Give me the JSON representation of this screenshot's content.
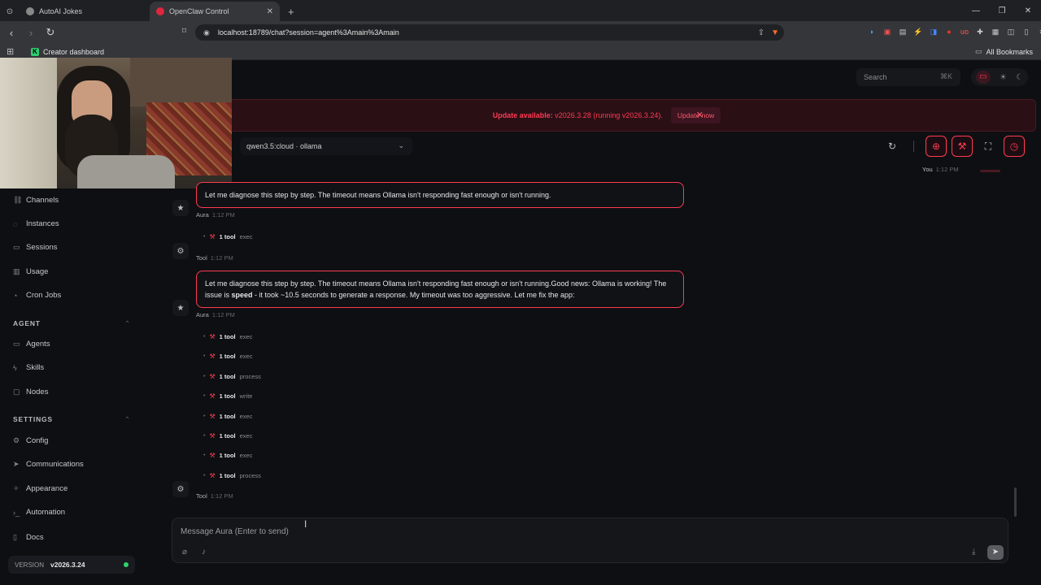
{
  "browser": {
    "tabs": [
      {
        "title": "AutoAI Jokes"
      },
      {
        "title": "OpenClaw Control"
      }
    ],
    "url": "localhost:18789/chat?session=agent%3Amain%3Amain",
    "bookmark": "Creator dashboard",
    "all_bookmarks": "All Bookmarks"
  },
  "header": {
    "search_placeholder": "Search",
    "search_kbd": "⌘K"
  },
  "banner": {
    "label": "Update available:",
    "version_text": "v2026.3.28 (running v2026.3.24).",
    "button": "Update now"
  },
  "model_selector": {
    "value": "qwen3.5:cloud · ollama"
  },
  "sidebar": {
    "items_top": [
      {
        "label": "Channels",
        "icon": "link-icon"
      },
      {
        "label": "Instances",
        "icon": "radio-icon"
      },
      {
        "label": "Sessions",
        "icon": "file-icon"
      },
      {
        "label": "Usage",
        "icon": "chart-icon"
      },
      {
        "label": "Cron Jobs",
        "icon": "clock-icon"
      }
    ],
    "section_agent": "AGENT",
    "items_agent": [
      {
        "label": "Agents",
        "icon": "folder-icon"
      },
      {
        "label": "Skills",
        "icon": "zap-icon"
      },
      {
        "label": "Nodes",
        "icon": "monitor-icon"
      }
    ],
    "section_settings": "SETTINGS",
    "items_settings": [
      {
        "label": "Config",
        "icon": "gear-icon"
      },
      {
        "label": "Communications",
        "icon": "send-icon"
      },
      {
        "label": "Appearance",
        "icon": "sparkle-icon"
      },
      {
        "label": "Automation",
        "icon": "terminal-icon"
      }
    ],
    "docs": "Docs",
    "version_label": "VERSION",
    "version_value": "v2026.3.24"
  },
  "chat": {
    "you_label": "You",
    "you_time": "1:12 PM",
    "msg1": "Let me diagnose this step by step. The timeout means Ollama isn't responding fast enough or isn't running.",
    "msg1_author": "Aura",
    "msg1_time": "1:12 PM",
    "tool_group1": [
      {
        "count": "1 tool",
        "name": "exec"
      }
    ],
    "tool1_author": "Tool",
    "tool1_time": "1:12 PM",
    "msg2_part1": "Let me diagnose this step by step. The timeout means Ollama isn't responding fast enough or isn't running.Good news: Ollama is working! The issue is ",
    "msg2_bold": "speed",
    "msg2_part2": " - it took ~10.5 seconds to generate a response. My timeout was too aggressive. Let me fix the app:",
    "msg2_author": "Aura",
    "msg2_time": "1:12 PM",
    "tool_group2": [
      {
        "count": "1 tool",
        "name": "exec"
      },
      {
        "count": "1 tool",
        "name": "exec"
      },
      {
        "count": "1 tool",
        "name": "process"
      },
      {
        "count": "1 tool",
        "name": "write"
      },
      {
        "count": "1 tool",
        "name": "exec"
      },
      {
        "count": "1 tool",
        "name": "exec"
      },
      {
        "count": "1 tool",
        "name": "exec"
      },
      {
        "count": "1 tool",
        "name": "process"
      }
    ],
    "tool2_author": "Tool",
    "tool2_time": "1:12 PM"
  },
  "composer": {
    "placeholder": "Message Aura (Enter to send)"
  },
  "colors": {
    "accent": "#ff3b52",
    "background": "#0e0f12",
    "online": "#2fd36b"
  }
}
